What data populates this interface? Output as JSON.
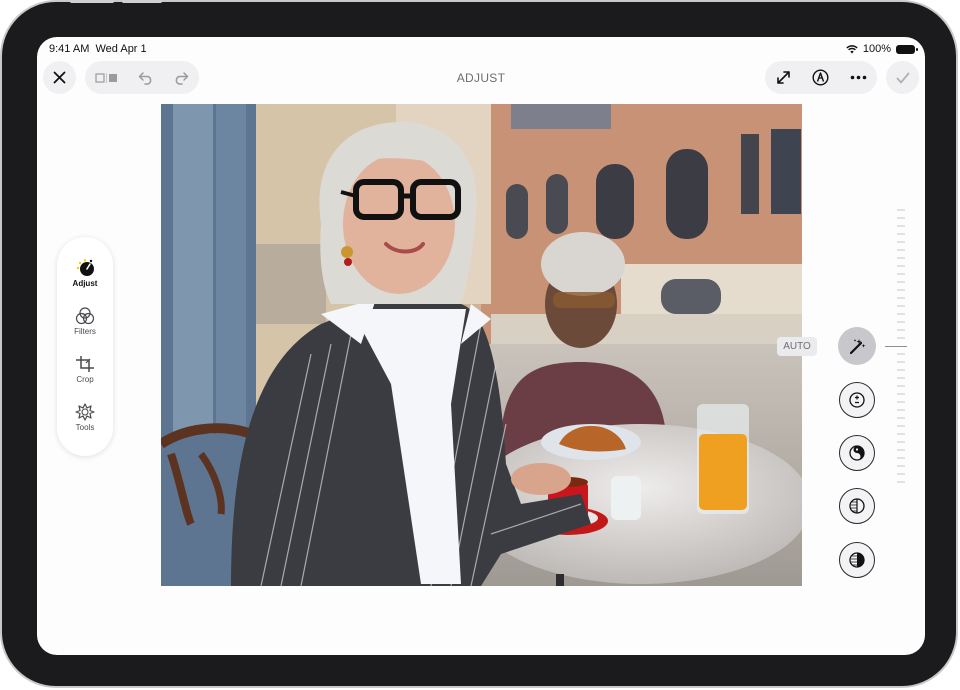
{
  "status_bar": {
    "time": "9:41 AM",
    "date": "Wed Apr 1",
    "battery": "100%"
  },
  "header": {
    "title": "ADJUST"
  },
  "sidebar": {
    "items": [
      {
        "label": "Adjust",
        "icon": "adjust-dial-icon",
        "active": true
      },
      {
        "label": "Filters",
        "icon": "filters-icon",
        "active": false
      },
      {
        "label": "Crop",
        "icon": "crop-icon",
        "active": false
      },
      {
        "label": "Tools",
        "icon": "tools-icon",
        "active": false
      }
    ]
  },
  "adjust_panel": {
    "auto_label": "AUTO",
    "tools": [
      "auto-enhance-icon",
      "exposure-icon",
      "brilliance-icon",
      "highlights-icon",
      "shadows-icon"
    ]
  },
  "colors": {
    "accent": "#ffcc00",
    "device": "#1b1b1d",
    "toolbar_bg": "#f0f0f2"
  }
}
